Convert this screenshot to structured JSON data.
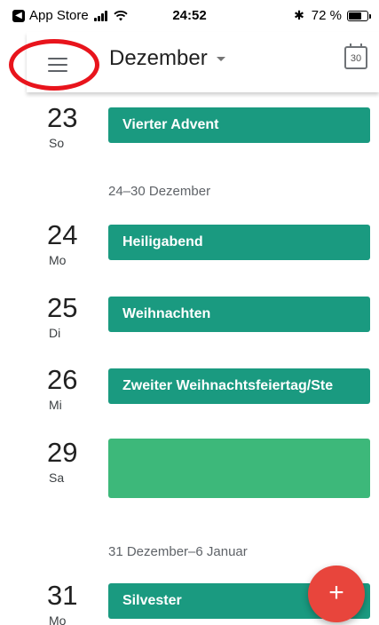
{
  "status_bar": {
    "back_app": "App Store",
    "time": "24:52",
    "battery_percent": "72 %",
    "battery_level": 0.72
  },
  "app_bar": {
    "month": "Dezember",
    "today_icon_day": "30",
    "annotation_color": "#e8141c"
  },
  "schedule": {
    "days": [
      {
        "num": "23",
        "weekday": "So",
        "events": [
          {
            "title": "Vierter Advent",
            "color": "#1a9a80"
          }
        ]
      },
      {
        "num": "24",
        "weekday": "Mo",
        "events": [
          {
            "title": "Heiligabend",
            "color": "#1a9a80"
          }
        ]
      },
      {
        "num": "25",
        "weekday": "Di",
        "events": [
          {
            "title": "Weihnachten",
            "color": "#1a9a80"
          }
        ]
      },
      {
        "num": "26",
        "weekday": "Mi",
        "events": [
          {
            "title": "Zweiter Weihnachtsfeiertag/Ste",
            "color": "#1a9a80"
          }
        ]
      },
      {
        "num": "29",
        "weekday": "Sa",
        "events": [
          {
            "title": "",
            "color": "#3db87a"
          }
        ]
      },
      {
        "num": "31",
        "weekday": "Mo",
        "events": [
          {
            "title": "Silvester",
            "color": "#1a9a80"
          }
        ]
      }
    ],
    "week_labels": [
      "24–30 Dezember",
      "31 Dezember–6 Januar"
    ]
  },
  "fab": {
    "label": "+",
    "color": "#e8453c"
  }
}
